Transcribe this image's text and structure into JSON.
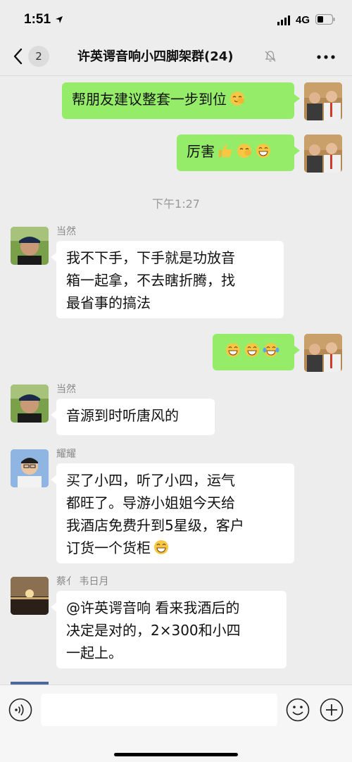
{
  "status_bar": {
    "time": "1:51",
    "network": "4G"
  },
  "nav": {
    "unread_count": "2",
    "title": "许英谔音响小四脚架群(24)"
  },
  "messages": {
    "m1_text": "帮朋友建议整套一步到位",
    "m2_text": "厉害",
    "timestamp": "下午1:27",
    "m3_sender": "当然",
    "m3_line1": "我不下手，下手就是功放音",
    "m3_line2": "箱一起拿，不去瞎折腾，找",
    "m3_line3": "最省事的搞法",
    "m5_sender": "当然",
    "m5_text": "音源到时听唐风的",
    "m6_sender": "耀耀",
    "m6_line1": "买了小四，听了小四，运气",
    "m6_line2": "都旺了。导游小姐姐今天给",
    "m6_line3": "我酒店免费升到5星级，客户",
    "m6_line4": "订货一个货柜",
    "m7_sender": "蔡亻 韦日月",
    "m7_line1": "@许英谔音响 看来我酒后的",
    "m7_line2": "决定是对的，2×300和小四",
    "m7_line3": "一起上。"
  },
  "input": {
    "placeholder": ""
  },
  "colors": {
    "background": "#ededed",
    "self_bubble": "#95ec69",
    "other_bubble": "#ffffff"
  },
  "icons": [
    "location-arrow-icon",
    "signal-icon",
    "battery-icon",
    "back-chevron-icon",
    "mute-bell-icon",
    "more-dots-icon",
    "voice-icon",
    "emoji-face-icon",
    "plus-icon",
    "facepalm-emoji",
    "thumbs-up-emoji",
    "grin-emoji",
    "tears-of-joy-emoji"
  ]
}
